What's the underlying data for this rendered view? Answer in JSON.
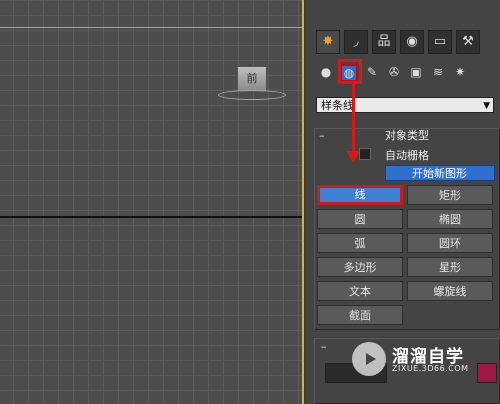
{
  "viewport": {
    "viewcube_label": "前"
  },
  "command_panel": {
    "tabs": [
      {
        "icon": "sun-icon",
        "glyph": "✸",
        "active": true
      },
      {
        "icon": "curve-icon",
        "glyph": "◞"
      },
      {
        "icon": "hierarchy-icon",
        "glyph": "品"
      },
      {
        "icon": "motion-icon",
        "glyph": "◉"
      },
      {
        "icon": "display-icon",
        "glyph": "▭"
      },
      {
        "icon": "hammer-icon",
        "glyph": "⚒"
      }
    ],
    "subtabs": [
      {
        "icon": "geometry-icon",
        "glyph": "●"
      },
      {
        "icon": "shapes-icon",
        "glyph": "◍",
        "active": true
      },
      {
        "icon": "lights-icon",
        "glyph": "✎"
      },
      {
        "icon": "cameras-icon",
        "glyph": "✇"
      },
      {
        "icon": "helpers-icon",
        "glyph": "▣"
      },
      {
        "icon": "spacewarps-icon",
        "glyph": "≋"
      },
      {
        "icon": "systems-icon",
        "glyph": "✷"
      }
    ],
    "category_dropdown": {
      "value": "样条线",
      "caret": "▼"
    },
    "object_type": {
      "header": "对象类型",
      "collapse": "–",
      "auto_grid": "自动栅格",
      "start_new_shape": "开始新图形",
      "buttons": [
        "线",
        "矩形",
        "圆",
        "椭圆",
        "弧",
        "圆环",
        "多边形",
        "星形",
        "文本",
        "螺旋线",
        "截面"
      ]
    },
    "name_color": {
      "collapse": "–"
    }
  },
  "watermark": {
    "brand": "溜溜自学",
    "url": "ZIXUE.3D66.COM"
  },
  "colors": {
    "accent": "#d41a1a",
    "active_button": "#3f7fd6",
    "swatch": "#9a1a43"
  }
}
